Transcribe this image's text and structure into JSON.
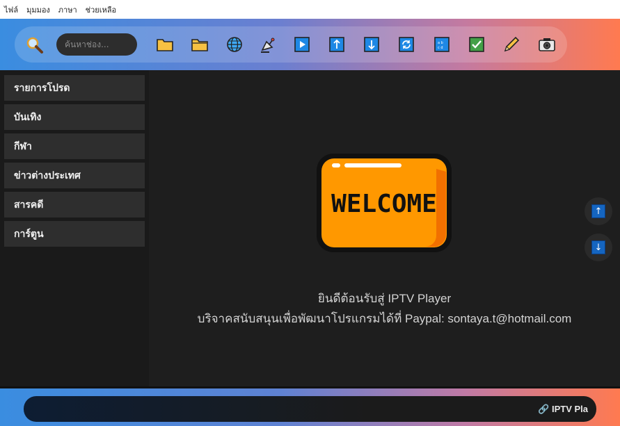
{
  "menu": [
    "ไฟล์",
    "มุมมอง",
    "ภาษา",
    "ช่วยเหลือ"
  ],
  "search": {
    "placeholder": "ค้นหาช่อง..."
  },
  "toolbar_icons": [
    "folder-icon",
    "folder-open-icon",
    "globe-icon",
    "satellite-icon",
    "play-icon",
    "arrow-up-icon",
    "arrow-down-icon",
    "refresh-icon",
    "text-grid-icon",
    "checkmark-icon",
    "pencil-icon",
    "camera-icon"
  ],
  "sidebar": {
    "items": [
      {
        "label": "รายการโปรด"
      },
      {
        "label": "บันเทิง"
      },
      {
        "label": "กีฬา"
      },
      {
        "label": "ข่าวต่างประเทศ"
      },
      {
        "label": "สารคดี"
      },
      {
        "label": "การ์ตูน"
      }
    ]
  },
  "main": {
    "welcome_label": "WELCOME",
    "line1": "ยินดีต้อนรับสู่ IPTV Player",
    "line2": "บริจาคสนับสนุนเพื่อพัฒนาโปรแกรมได้ที่ Paypal: sontaya.t@hotmail.com"
  },
  "ticker": {
    "text": "🔗 IPTV Pla"
  },
  "colors": {
    "accent_blue": "#3a8de0",
    "accent_orange": "#ff7a50",
    "welcome_orange": "#ff9800"
  }
}
